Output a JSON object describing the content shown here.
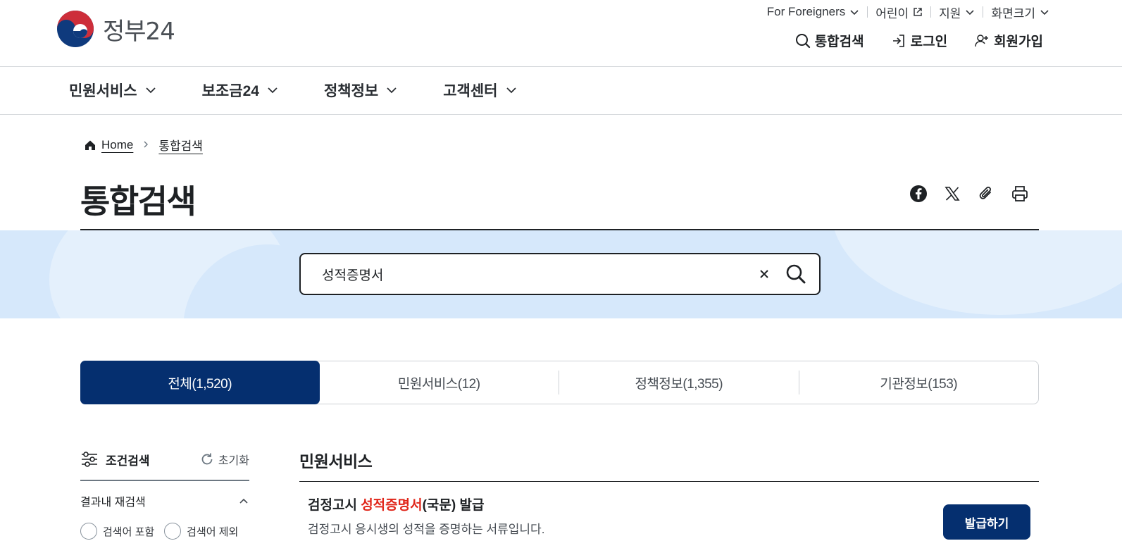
{
  "header": {
    "logo_text": "정부24",
    "util": {
      "foreigners": "For Foreigners",
      "kids": "어린이",
      "region": "지원",
      "screen_size": "화면크기"
    },
    "account": {
      "search": "통합검색",
      "login": "로그인",
      "signup": "회원가입"
    }
  },
  "gnb": {
    "items": [
      {
        "label": "민원서비스"
      },
      {
        "label": "보조금24"
      },
      {
        "label": "정책정보"
      },
      {
        "label": "고객센터"
      }
    ]
  },
  "breadcrumb": {
    "home": "Home",
    "current": "통합검색"
  },
  "page": {
    "title": "통합검색"
  },
  "search": {
    "value": "성적증명서",
    "clear_symbol": "×"
  },
  "tabs": [
    {
      "label": "전체(1,520)",
      "active": true
    },
    {
      "label": "민원서비스(12)",
      "active": false
    },
    {
      "label": "정책정보(1,355)",
      "active": false
    },
    {
      "label": "기관정보(153)",
      "active": false
    }
  ],
  "filter": {
    "title": "조건검색",
    "reset": "초기화",
    "section": "결과내 재검색",
    "options": [
      "검색어 포함",
      "검색어 제외"
    ]
  },
  "results": {
    "section_title": "민원서비스",
    "items": [
      {
        "title_prefix": "검정고시 ",
        "title_highlight": "성적증명서",
        "title_suffix": "(국문) 발급",
        "description": "검정고시 응시생의 성적을 증명하는 서류입니다.",
        "button": "발급하기"
      }
    ]
  },
  "colors": {
    "primary": "#052f6f",
    "highlight": "#e0261a",
    "banner": "#d6e8fb",
    "logo_red": "#cd2e3a",
    "logo_blue": "#0f3a7d"
  }
}
